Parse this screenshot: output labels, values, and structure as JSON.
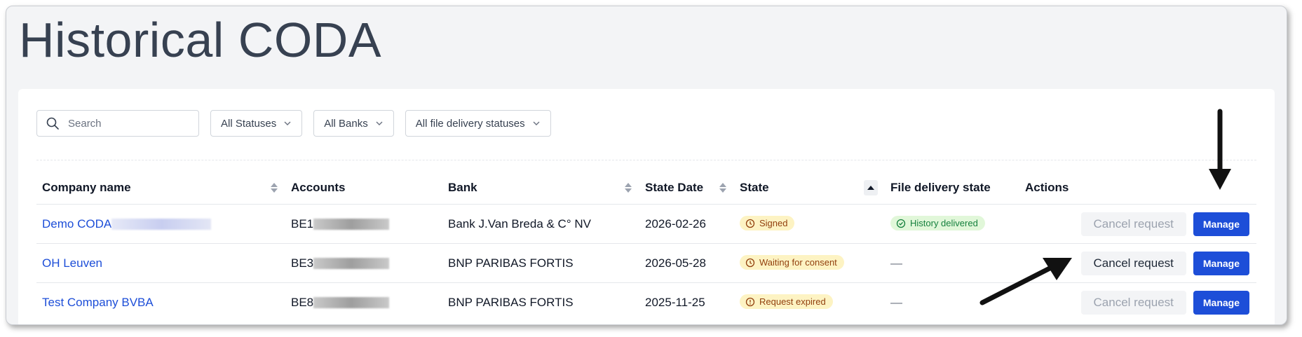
{
  "page": {
    "title": "Historical CODA"
  },
  "filters": {
    "search_placeholder": "Search",
    "status": "All Statuses",
    "bank": "All Banks",
    "delivery": "All file delivery statuses"
  },
  "table": {
    "headers": {
      "company": "Company name",
      "accounts": "Accounts",
      "bank": "Bank",
      "state_date": "State Date",
      "state": "State",
      "file_delivery": "File delivery state",
      "actions": "Actions"
    },
    "rows": [
      {
        "company": "Demo CODA",
        "account": "BE1",
        "bank": "Bank J.Van Breda & C° NV",
        "state_date": "2026-02-26",
        "state": "Signed",
        "file_delivery": "History delivered",
        "cancel": "Cancel request",
        "manage": "Manage"
      },
      {
        "company": "OH Leuven",
        "account": "BE3",
        "bank": "BNP PARIBAS FORTIS",
        "state_date": "2026-05-28",
        "state": "Waiting for consent",
        "file_delivery": "—",
        "cancel": "Cancel request",
        "manage": "Manage"
      },
      {
        "company": "Test Company BVBA",
        "account": "BE8",
        "bank": "BNP PARIBAS FORTIS",
        "state_date": "2025-11-25",
        "state": "Request expired",
        "file_delivery": "—",
        "cancel": "Cancel request",
        "manage": "Manage"
      }
    ]
  },
  "colors": {
    "primary": "#1d4ed8",
    "badge_yellow": "#fdf3c3",
    "badge_green": "#e1f7d9",
    "annotation_arrow": "#111111"
  },
  "icons": [
    "search-icon",
    "chevron-down-icon",
    "sort-icon",
    "sort-ascending-icon",
    "clock-icon",
    "check-circle-icon",
    "alert-circle-icon",
    "annotation-arrow"
  ]
}
